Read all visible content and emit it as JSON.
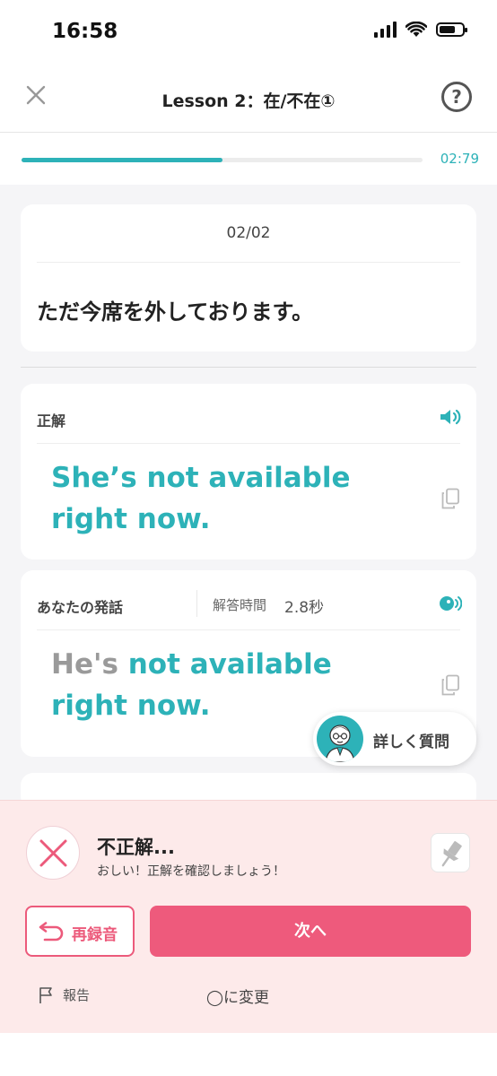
{
  "status": {
    "time": "16:58"
  },
  "nav": {
    "title": "Lesson 2：在/不在①",
    "help_glyph": "?"
  },
  "progress": {
    "fraction": 0.5,
    "time": "02:79"
  },
  "question": {
    "count": "02/02",
    "text": "ただ今席を外しております。"
  },
  "correct": {
    "label": "正解",
    "answer": "She’s not available right now."
  },
  "user": {
    "label": "あなたの発話",
    "time_label": "解答時間",
    "time_value": "2.8秒",
    "wrong_part": "He's",
    "right_part": " not available right now."
  },
  "ask": {
    "label": "詳しく質問"
  },
  "result": {
    "title": "不正解...",
    "subtitle": "おしい！正解を確認しましょう！"
  },
  "actions": {
    "rerecord": "再録音",
    "next": "次へ",
    "report": "報告",
    "change": "◯に変更"
  },
  "colors": {
    "accent": "#2db2b8",
    "error": "#ee5a7c",
    "panel": "#fdeaea"
  }
}
